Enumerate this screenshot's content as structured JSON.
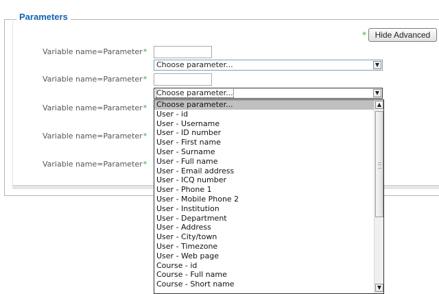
{
  "legend": "Parameters",
  "required_mark": "*",
  "hide_advanced_label": "Hide Advanced",
  "rows": [
    {
      "label": "Variable name=Parameter",
      "select_value": "Choose parameter..."
    },
    {
      "label": "Variable name=Parameter",
      "select_value": "Choose parameter..."
    },
    {
      "label": "Variable name=Parameter"
    },
    {
      "label": "Variable name=Parameter"
    },
    {
      "label": "Variable name=Parameter"
    }
  ],
  "dropdown": {
    "selected": "Choose parameter...",
    "options": [
      "Choose parameter...",
      "User - id",
      "User - Username",
      "User - ID number",
      "User - First name",
      "User - Surname",
      "User - Full name",
      "User - Email address",
      "User - ICQ number",
      "User - Phone 1",
      "User - Mobile Phone 2",
      "User - Institution",
      "User - Department",
      "User - Address",
      "User - City/town",
      "User - Timezone",
      "User - Web page",
      "Course - id",
      "Course - Full name",
      "Course - Short name"
    ]
  },
  "icons": {
    "select_arrow": "chevron-down-icon",
    "scroll_up": "chevron-up-icon",
    "scroll_down": "chevron-down-icon"
  }
}
